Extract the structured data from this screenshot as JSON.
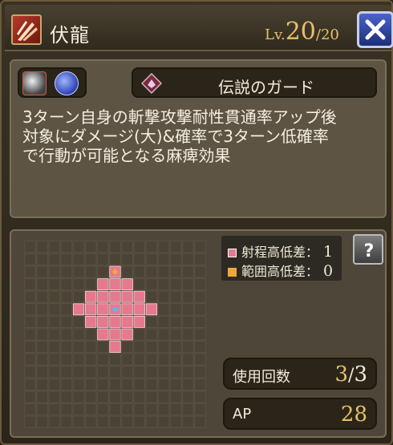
{
  "header": {
    "icon": "skill-slash-icon",
    "title": "伏龍",
    "level_prefix": "Lv.",
    "level_current": "20",
    "level_max": "/20",
    "close_icon": "close-x-icon"
  },
  "description": {
    "attribute_icons": [
      "slash-attribute-icon",
      "thunder-attribute-icon"
    ],
    "action_icon": "guard-emblem-icon",
    "action_label": "伝説のガード",
    "text_lines": [
      "3ターン自身の斬撃攻撃耐性貫通率アップ後",
      "対象にダメージ(大)&確率で3ターン低確率",
      "で行動が可能となる麻痺効果"
    ]
  },
  "range": {
    "grid_size": 15,
    "legend": [
      {
        "label": "射程高低差：",
        "value": "1",
        "color": "#e57a8e"
      },
      {
        "label": "範囲高低差：",
        "value": "0",
        "color": "#f0a640"
      }
    ],
    "help_icon": "help-question-icon",
    "area_cells": [
      [
        6,
        3
      ],
      [
        7,
        3
      ],
      [
        8,
        3
      ],
      [
        5,
        4
      ],
      [
        6,
        4
      ],
      [
        7,
        4
      ],
      [
        8,
        4
      ],
      [
        9,
        4
      ],
      [
        4,
        5
      ],
      [
        5,
        5
      ],
      [
        6,
        5
      ],
      [
        7,
        5
      ],
      [
        8,
        5
      ],
      [
        9,
        5
      ],
      [
        10,
        5
      ],
      [
        5,
        6
      ],
      [
        6,
        6
      ],
      [
        7,
        6
      ],
      [
        8,
        6
      ],
      [
        9,
        6
      ],
      [
        6,
        7
      ],
      [
        7,
        7
      ],
      [
        8,
        7
      ],
      [
        7,
        8
      ]
    ],
    "target_cell": [
      7,
      2
    ],
    "center_cell": [
      7,
      5
    ],
    "colors": {
      "area": "#e57a8e",
      "target": "#f0a640",
      "center": "#5ab4ff",
      "cell": "#4a4336",
      "cell_border": "#5c5444"
    }
  },
  "stats": {
    "uses_label": "使用回数",
    "uses_current": "3",
    "uses_sep": "/",
    "uses_max": "3",
    "ap_label": "AP",
    "ap_value": "28"
  }
}
